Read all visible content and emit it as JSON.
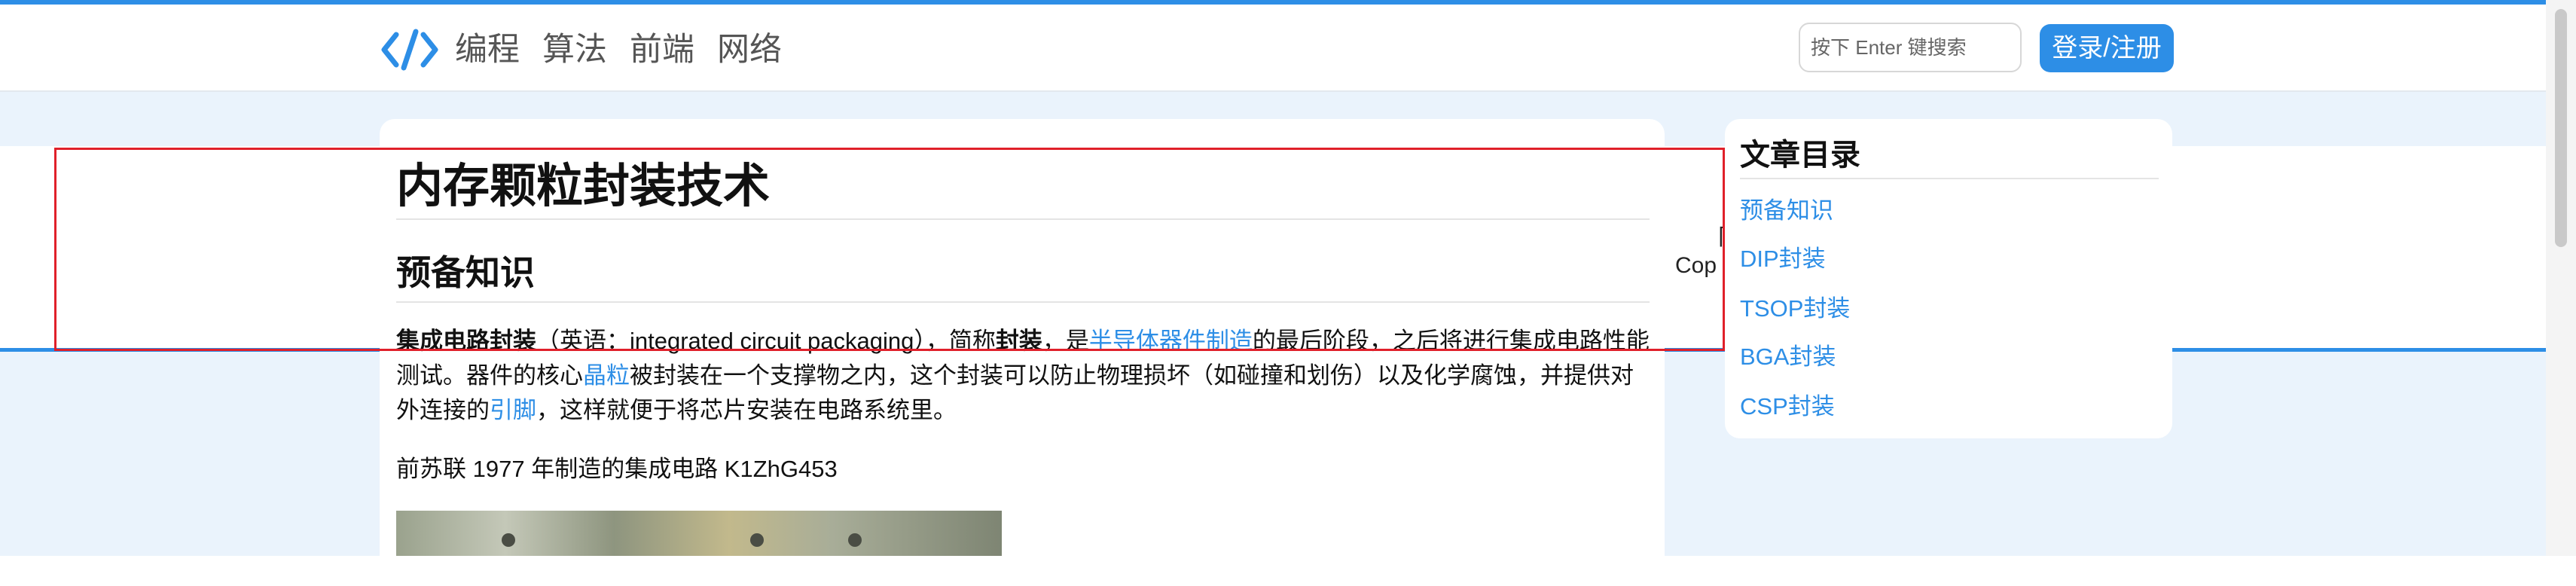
{
  "header": {
    "logo_icon": "code-brackets-icon",
    "nav": [
      "编程",
      "算法",
      "前端",
      "网络"
    ],
    "search_placeholder": "按下 Enter 键搜索",
    "login_label": "登录/注册"
  },
  "colors": {
    "accent": "#2d8ee6",
    "page_background": "#eaf3fc",
    "highlight": "#e0202a"
  },
  "footer_fragments": [
    "阝",
    "Cop"
  ],
  "article": {
    "title": "内存颗粒封装技术",
    "section_heading": "预备知识",
    "paragraph": {
      "bold1": "集成电路封装",
      "t1": "（英语：integrated circuit packaging），简称",
      "bold2": "封装",
      "t2": "，是",
      "link1": "半导体器件制造",
      "t3": "的最后阶段，之后将进行集成电路性能测试。器件的核心",
      "link2": "晶粒",
      "t4": "被封装在一个支撑物之内，这个封装可以防止物理损坏（如碰撞和划伤）以及化学腐蚀，并提供对外连接的",
      "link3": "引脚",
      "t5": "，这样就便于将芯片安装在电路系统里。"
    },
    "caption": "前苏联 1977 年制造的集成电路 K1ZhG453",
    "image_icon": "integrated-circuit-photo"
  },
  "toc": {
    "title": "文章目录",
    "items": [
      "预备知识",
      "DIP封装",
      "TSOP封装",
      "BGA封装",
      "CSP封装"
    ]
  }
}
